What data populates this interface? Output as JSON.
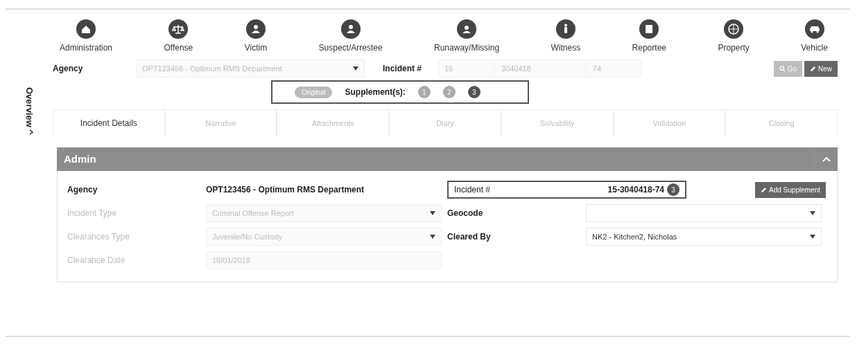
{
  "sidebar": {
    "label": "Overview",
    "expanded": true
  },
  "modules": [
    {
      "label": "Administration"
    },
    {
      "label": "Offense"
    },
    {
      "label": "Victim"
    },
    {
      "label": "Suspect/Arrestee"
    },
    {
      "label": "Runaway/Missing"
    },
    {
      "label": "Witness"
    },
    {
      "label": "Reportee"
    },
    {
      "label": "Property"
    },
    {
      "label": "Vehicle"
    }
  ],
  "search": {
    "agency_label": "Agency",
    "agency_value": "OPT123456 - Optimum RMS Department",
    "incident_label": "Incident #",
    "incident_parts": [
      "15",
      "3040418",
      "74"
    ],
    "buttons": [
      {
        "label": "Go",
        "kind": "light"
      },
      {
        "label": "New",
        "kind": "dark"
      }
    ]
  },
  "supplements": {
    "original": "Original",
    "label": "Supplement(s):",
    "items": [
      {
        "label": "1",
        "selected": false
      },
      {
        "label": "2",
        "selected": false
      },
      {
        "label": "3",
        "selected": true
      }
    ]
  },
  "tabs": [
    {
      "label": "Incident Details",
      "selected": true
    },
    {
      "label": "Narrative",
      "selected": false
    },
    {
      "label": "Attachments",
      "selected": false
    },
    {
      "label": "Diary",
      "selected": false
    },
    {
      "label": "Solvability",
      "selected": false
    },
    {
      "label": "Validation",
      "selected": false
    },
    {
      "label": "Closing",
      "selected": false
    }
  ],
  "panel": {
    "title": "Admin",
    "expanded": true,
    "left": [
      {
        "label": "Agency",
        "value": "OPT123456 - Optimum RMS Department",
        "kind": "text"
      },
      {
        "label": "Incident Type",
        "value": "Criminal Offense Report",
        "kind": "select",
        "disabled": true
      },
      {
        "label": "Clearances Type",
        "value": "Juvenile/No Custody",
        "kind": "select",
        "disabled": true
      },
      {
        "label": "Clearance Date",
        "value": "10/01/2018",
        "kind": "input",
        "disabled": true
      }
    ],
    "incident": {
      "label": "Incident #",
      "value": "15-3040418-74",
      "badge": "3"
    },
    "add_button": "Add Supplement",
    "right": [
      {
        "label": "Geocode",
        "kind": "select",
        "disabled": false
      },
      {
        "label": "Cleared By",
        "value": "NK2 - Kitchen2, Nicholas",
        "kind": "select",
        "disabled": false
      }
    ]
  }
}
